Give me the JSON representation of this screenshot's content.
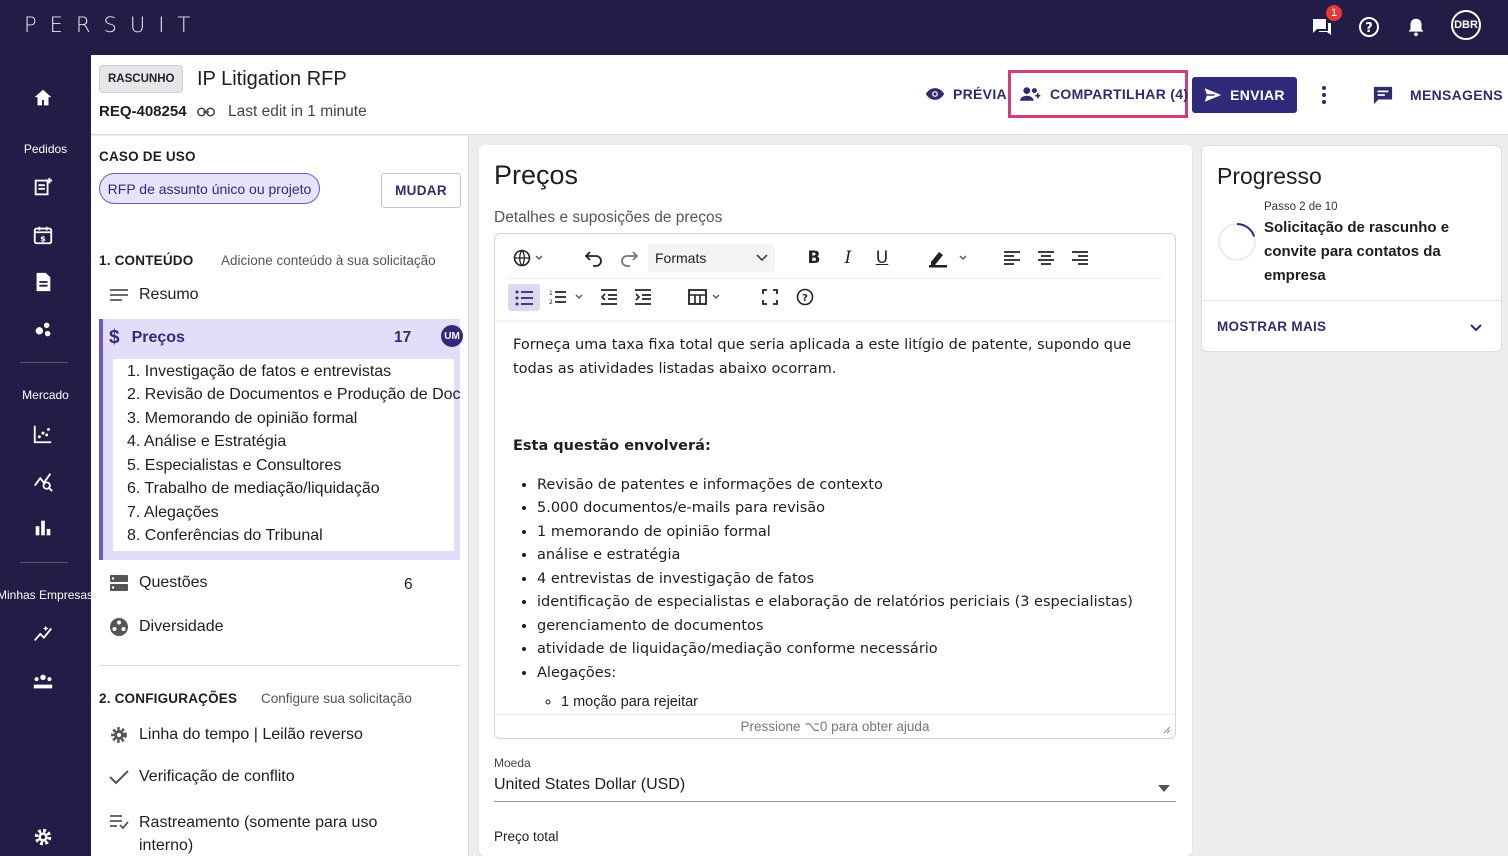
{
  "app": {
    "logo": "PERSUIT"
  },
  "topbar": {
    "chat_badge": "1",
    "user_initials": "DBR"
  },
  "rail": {
    "sections": [
      "Pedidos",
      "Mercado",
      "Minhas Empresas"
    ]
  },
  "header": {
    "status_tag": "RASCUNHO",
    "title": "IP Litigation RFP",
    "req_id": "REQ-408254",
    "last_edit": "Last edit in 1 minute",
    "preview_label": "PRÉVIA",
    "share_label": "COMPARTILHAR (4)",
    "send_label": "ENVIAR",
    "messages_label": "MENSAGENS"
  },
  "left": {
    "use_case_title": "CASO DE USO",
    "use_case_chip": "RFP de assunto único ou projeto",
    "change_label": "MUDAR",
    "content_title": "1. CONTEÚDO",
    "content_desc": "Adicione conteúdo à sua solicitação",
    "summary_label": "Resumo",
    "prices_label": "Preços",
    "prices_count": "17",
    "prices_avatar": "UM",
    "prices_items": [
      "1. Investigação de fatos e entrevistas",
      "2. Revisão de Documentos e Produção de Doc",
      "3. Memorando de opinião formal",
      "4. Análise e Estratégia",
      "5. Especialistas e Consultores",
      "6. Trabalho de mediação/liquidação",
      "7. Alegações",
      "8. Conferências do Tribunal"
    ],
    "questions_label": "Questões",
    "questions_count": "6",
    "diversity_label": "Diversidade",
    "config_title": "2. CONFIGURAÇÕES",
    "config_desc": "Configure sua solicitação",
    "timeline_label": "Linha do tempo | Leilão reverso",
    "conflict_label": "Verificação de conflito",
    "tracking_label_1": "Rastreamento (somente para uso",
    "tracking_label_2": "interno)"
  },
  "center": {
    "title": "Preços",
    "subtitle": "Detalhes e suposições de preços",
    "formats_label": "Formats",
    "paragraph": "Forneça uma taxa fixa total que seria aplicada a este litígio de patente, supondo que todas as atividades listadas abaixo ocorram.",
    "bold_heading": "Esta questão envolverá:",
    "bullets": [
      "Revisão de patentes e informações de contexto",
      "5.000 documentos/e-mails para revisão",
      "1 memorando de opinião formal",
      "análise e estratégia",
      "4 entrevistas de investigação de fatos",
      "identificação de especialistas e elaboração de relatórios periciais (3 especialistas)",
      "gerenciamento de documentos",
      "atividade de liquidação/mediação conforme necessário",
      "Alegações:"
    ],
    "sub_bullet": "1 moção para rejeitar",
    "help_text": "Pressione ⌥0 para obter ajuda",
    "currency_label": "Moeda",
    "currency_value": "United States Dollar (USD)",
    "total_label": "Preço total"
  },
  "right": {
    "title": "Progresso",
    "step_label": "Passo 2 de 10",
    "step_title": "Solicitação de rascunho e convite para contatos da empresa",
    "show_more": "MOSTRAR MAIS",
    "progress_fraction": 0.2
  }
}
